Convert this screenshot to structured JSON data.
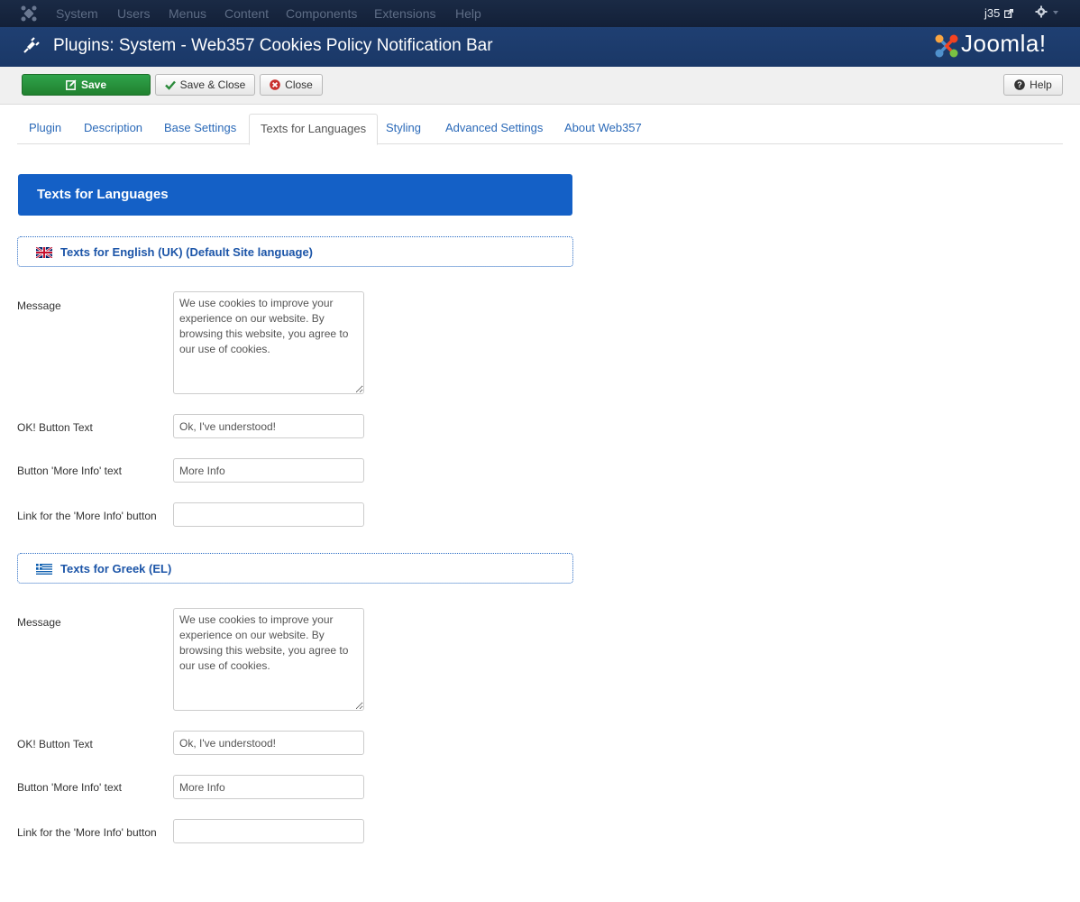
{
  "topnav": {
    "menu": [
      "System",
      "Users",
      "Menus",
      "Content",
      "Components",
      "Extensions",
      "Help"
    ],
    "user": "j35",
    "icons": {
      "logo": "joomla-icon",
      "external": "external-link-icon",
      "settings": "gear-icon"
    }
  },
  "header": {
    "title": "Plugins: System - Web357 Cookies Policy Notification Bar",
    "brand": "Joomla!"
  },
  "toolbar": {
    "save_label": "Save",
    "save_close_label": "Save & Close",
    "close_label": "Close",
    "help_label": "Help"
  },
  "tabs": [
    {
      "label": "Plugin"
    },
    {
      "label": "Description"
    },
    {
      "label": "Base Settings"
    },
    {
      "label": "Texts for Languages",
      "active": true
    },
    {
      "label": "Styling"
    },
    {
      "label": "Advanced Settings"
    },
    {
      "label": "About Web357"
    }
  ],
  "section": {
    "title": "Texts for Languages"
  },
  "languages": [
    {
      "title": "Texts for English (UK) (Default Site language)",
      "flag": "uk-flag-icon",
      "message_label": "Message",
      "message_value": "We use cookies to improve your experience on our website. By browsing this website, you agree to our use of cookies.",
      "ok_label": "OK! Button Text",
      "ok_value": "Ok, I've understood!",
      "more_label": "Button 'More Info' text",
      "more_value": "More Info",
      "link_label": "Link for the 'More Info' button",
      "link_value": ""
    },
    {
      "title": "Texts for Greek (EL)",
      "flag": "greece-flag-icon",
      "message_label": "Message",
      "message_value": "We use cookies to improve your experience on our website. By browsing this website, you agree to our use of cookies.",
      "ok_label": "OK! Button Text",
      "ok_value": "Ok, I've understood!",
      "more_label": "Button 'More Info' text",
      "more_value": "More Info",
      "link_label": "Link for the 'More Info' button",
      "link_value": ""
    }
  ],
  "colors": {
    "topnav": "#17243a",
    "titlebar": "#1f3f72",
    "save_button": "#2fa34b",
    "section_header": "#1460c6",
    "link": "#2a69b8"
  }
}
